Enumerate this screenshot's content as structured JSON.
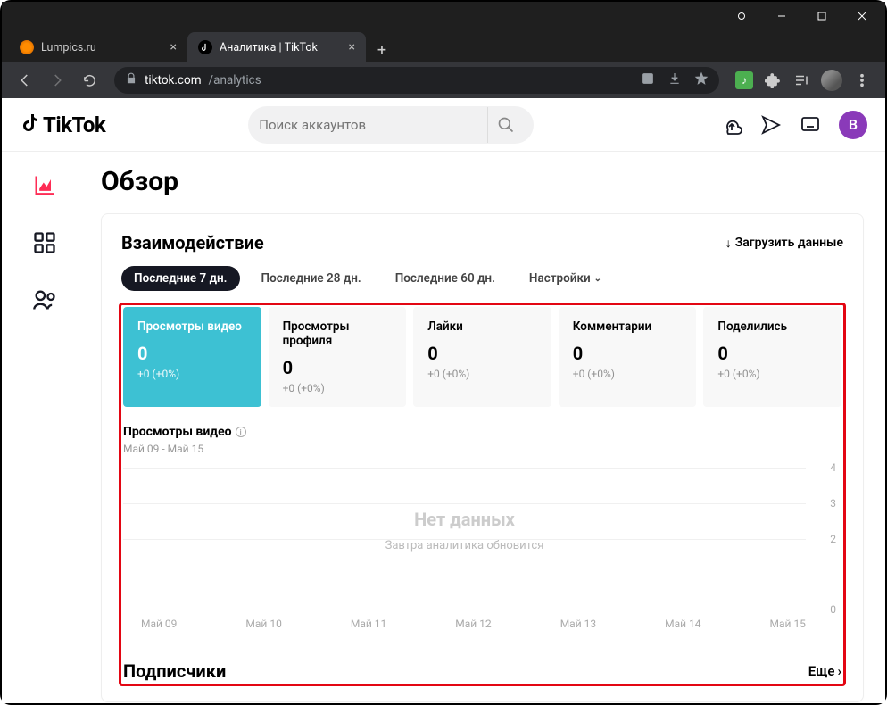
{
  "browser": {
    "tabs": [
      {
        "title": "Lumpics.ru",
        "active": false
      },
      {
        "title": "Аналитика | TikTok",
        "active": true
      }
    ],
    "url_domain": "tiktok.com",
    "url_path": "/analytics"
  },
  "header": {
    "logo": "TikTok",
    "search_placeholder": "Поиск аккаунтов",
    "user_initial": "В"
  },
  "page": {
    "title": "Обзор"
  },
  "engagement": {
    "title": "Взаимодействие",
    "download_label": "Загрузить данные",
    "ranges": [
      {
        "label": "Последние 7 дн.",
        "active": true
      },
      {
        "label": "Последние 28 дн.",
        "active": false
      },
      {
        "label": "Последние 60 дн.",
        "active": false
      }
    ],
    "settings_label": "Настройки",
    "metrics": [
      {
        "label": "Просмотры видео",
        "value": "0",
        "delta": "+0 (+0%)",
        "active": true
      },
      {
        "label": "Просмотры профиля",
        "value": "0",
        "delta": "+0 (+0%)",
        "active": false
      },
      {
        "label": "Лайки",
        "value": "0",
        "delta": "+0 (+0%)",
        "active": false
      },
      {
        "label": "Комментарии",
        "value": "0",
        "delta": "+0 (+0%)",
        "active": false
      },
      {
        "label": "Поделились",
        "value": "0",
        "delta": "+0 (+0%)",
        "active": false
      }
    ],
    "chart_title": "Просмотры видео",
    "chart_range": "Май 09 - Май 15",
    "chart_nodata": "Нет данных",
    "chart_nodata_sub": "Завтра аналитика обновится"
  },
  "subscribers": {
    "title": "Подписчики",
    "more_label": "Еще"
  },
  "chart_data": {
    "type": "line",
    "title": "Просмотры видео",
    "xlabel": "",
    "ylabel": "",
    "categories": [
      "Май 09",
      "Май 10",
      "Май 11",
      "Май 12",
      "Май 13",
      "Май 14",
      "Май 15"
    ],
    "values": [
      0,
      0,
      0,
      0,
      0,
      0,
      0
    ],
    "ylim": [
      0,
      4
    ],
    "yticks": [
      0,
      2,
      3,
      4
    ],
    "empty": true
  }
}
